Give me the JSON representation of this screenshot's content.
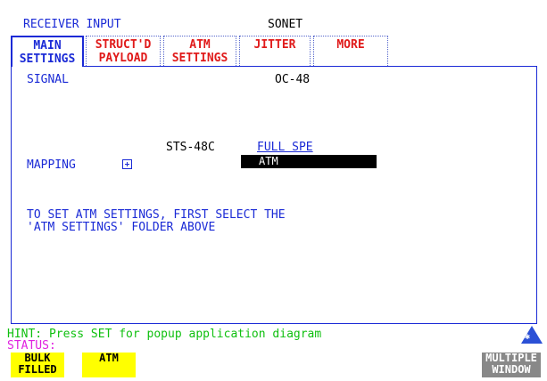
{
  "header": {
    "title": "RECEIVER INPUT",
    "mode": "SONET"
  },
  "tabs": [
    {
      "line1": "MAIN",
      "line2": "SETTINGS",
      "color": "#1a2ad6",
      "active": true
    },
    {
      "line1": "STRUCT'D",
      "line2": "PAYLOAD",
      "color": "#e01a1a",
      "active": false
    },
    {
      "line1": "ATM",
      "line2": "SETTINGS",
      "color": "#e01a1a",
      "active": false
    },
    {
      "line1": "JITTER",
      "line2": "",
      "color": "#e01a1a",
      "active": false
    },
    {
      "line1": "MORE",
      "line2": "",
      "color": "#e01a1a",
      "active": false
    }
  ],
  "main": {
    "signal_label": "SIGNAL",
    "signal_value": "OC-48",
    "mapping_label": "MAPPING",
    "mapping_value": "STS-48C",
    "mapping_type": "FULL SPE",
    "mapping_payload": "ATM",
    "instruction_line1": "TO SET ATM SETTINGS, FIRST SELECT THE",
    "instruction_line2": "'ATM SETTINGS' FOLDER ABOVE"
  },
  "hint": "HINT: Press SET for popup application diagram",
  "status_label": "STATUS:",
  "softkeys": [
    {
      "line1": "BULK",
      "line2": "FILLED"
    },
    {
      "line1": "ATM",
      "line2": ""
    }
  ],
  "multi_window": {
    "line1": "MULTIPLE",
    "line2": "WINDOW"
  },
  "icons": {
    "mapping_expand": "plus-box-icon",
    "status_indicator": "triangle-star-icon"
  }
}
